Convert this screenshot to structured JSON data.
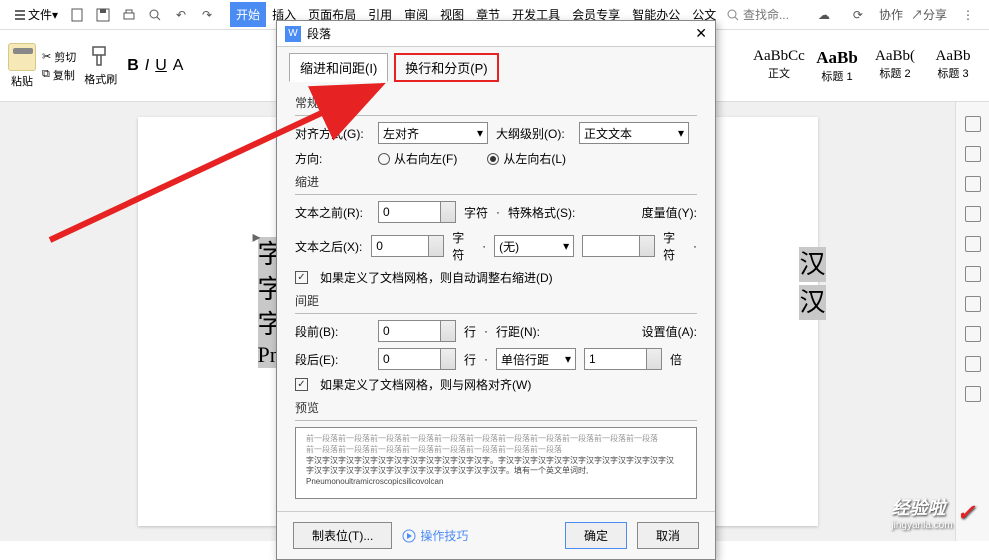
{
  "topbar": {
    "menu_label": "文件",
    "tabs": [
      "开始",
      "插入",
      "页面布局",
      "引用",
      "审阅",
      "视图",
      "章节",
      "开发工具",
      "会员专享",
      "智能办公",
      "公文"
    ],
    "search_placeholder": "查找命...",
    "collab_label": "协作",
    "share_label": "分享"
  },
  "ribbon": {
    "paste_label": "粘贴",
    "cut_label": "剪切",
    "copy_label": "复制",
    "format_label": "格式刷",
    "bold": "B",
    "italic": "I",
    "underline": "U",
    "strike": "A",
    "styles": [
      {
        "preview": "AaBbCc",
        "label": "正文"
      },
      {
        "preview": "AaBb",
        "label": "标题 1"
      },
      {
        "preview": "AaBb(",
        "label": "标题 2"
      },
      {
        "preview": "AaBb",
        "label": "标题 3"
      }
    ]
  },
  "document": {
    "line1": "字汉字",
    "line2": "字汉字",
    "line3": "字汉字",
    "line4": "Pneun",
    "trail": "汉",
    "trail2": "汉"
  },
  "dialog": {
    "title": "段落",
    "tab1": "缩进和间距(I)",
    "tab2": "换行和分页(P)",
    "section_general": "常规",
    "align_label": "对齐方式(G):",
    "align_value": "左对齐",
    "outline_label": "大纲级别(O):",
    "outline_value": "正文文本",
    "direction_label": "方向:",
    "rtl_label": "从右向左(F)",
    "ltr_label": "从左向右(L)",
    "section_indent": "缩进",
    "before_text_label": "文本之前(R):",
    "before_text_value": "0",
    "char_unit": "字符",
    "special_label": "特殊格式(S):",
    "measure_label": "度量值(Y):",
    "after_text_label": "文本之后(X):",
    "after_text_value": "0",
    "special_value": "(无)",
    "indent_check": "如果定义了文档网格，则自动调整右缩进(D)",
    "section_spacing": "间距",
    "before_para_label": "段前(B):",
    "before_para_value": "0",
    "line_unit": "行",
    "linespace_label": "行距(N):",
    "setvalue_label": "设置值(A):",
    "after_para_label": "段后(E):",
    "after_para_value": "0",
    "linespace_value": "单倍行距",
    "setvalue_value": "1",
    "bei_unit": "倍",
    "spacing_check": "如果定义了文档网格，则与网格对齐(W)",
    "section_preview": "预览",
    "preview_text1": "前一段落前一段落前一段落前一段落前一段落前一段落前一段落前一段落前一段落前一段落前一段落",
    "preview_text2": "前一段落前一段落前一段落前一段落前一段落前一段落前一段落前一段落",
    "preview_text3": "字汉字汉字汉字汉字汉字汉字汉字汉字汉字汉字汉字。字汉字汉字汉字汉字汉字汉字汉字汉字汉字汉字汉",
    "preview_text4": "字汉字汉字汉字汉字汉字汉字汉字汉字汉字汉字汉字汉字。填有一个英文单词时,",
    "preview_text5": "Pneumonoultramicroscopicsilicovolcan",
    "tabstop_btn": "制表位(T)...",
    "tips_label": "操作技巧",
    "ok_btn": "确定",
    "cancel_btn": "取消"
  },
  "watermark": {
    "main": "经验啦",
    "sub": "jingyanla.com"
  }
}
